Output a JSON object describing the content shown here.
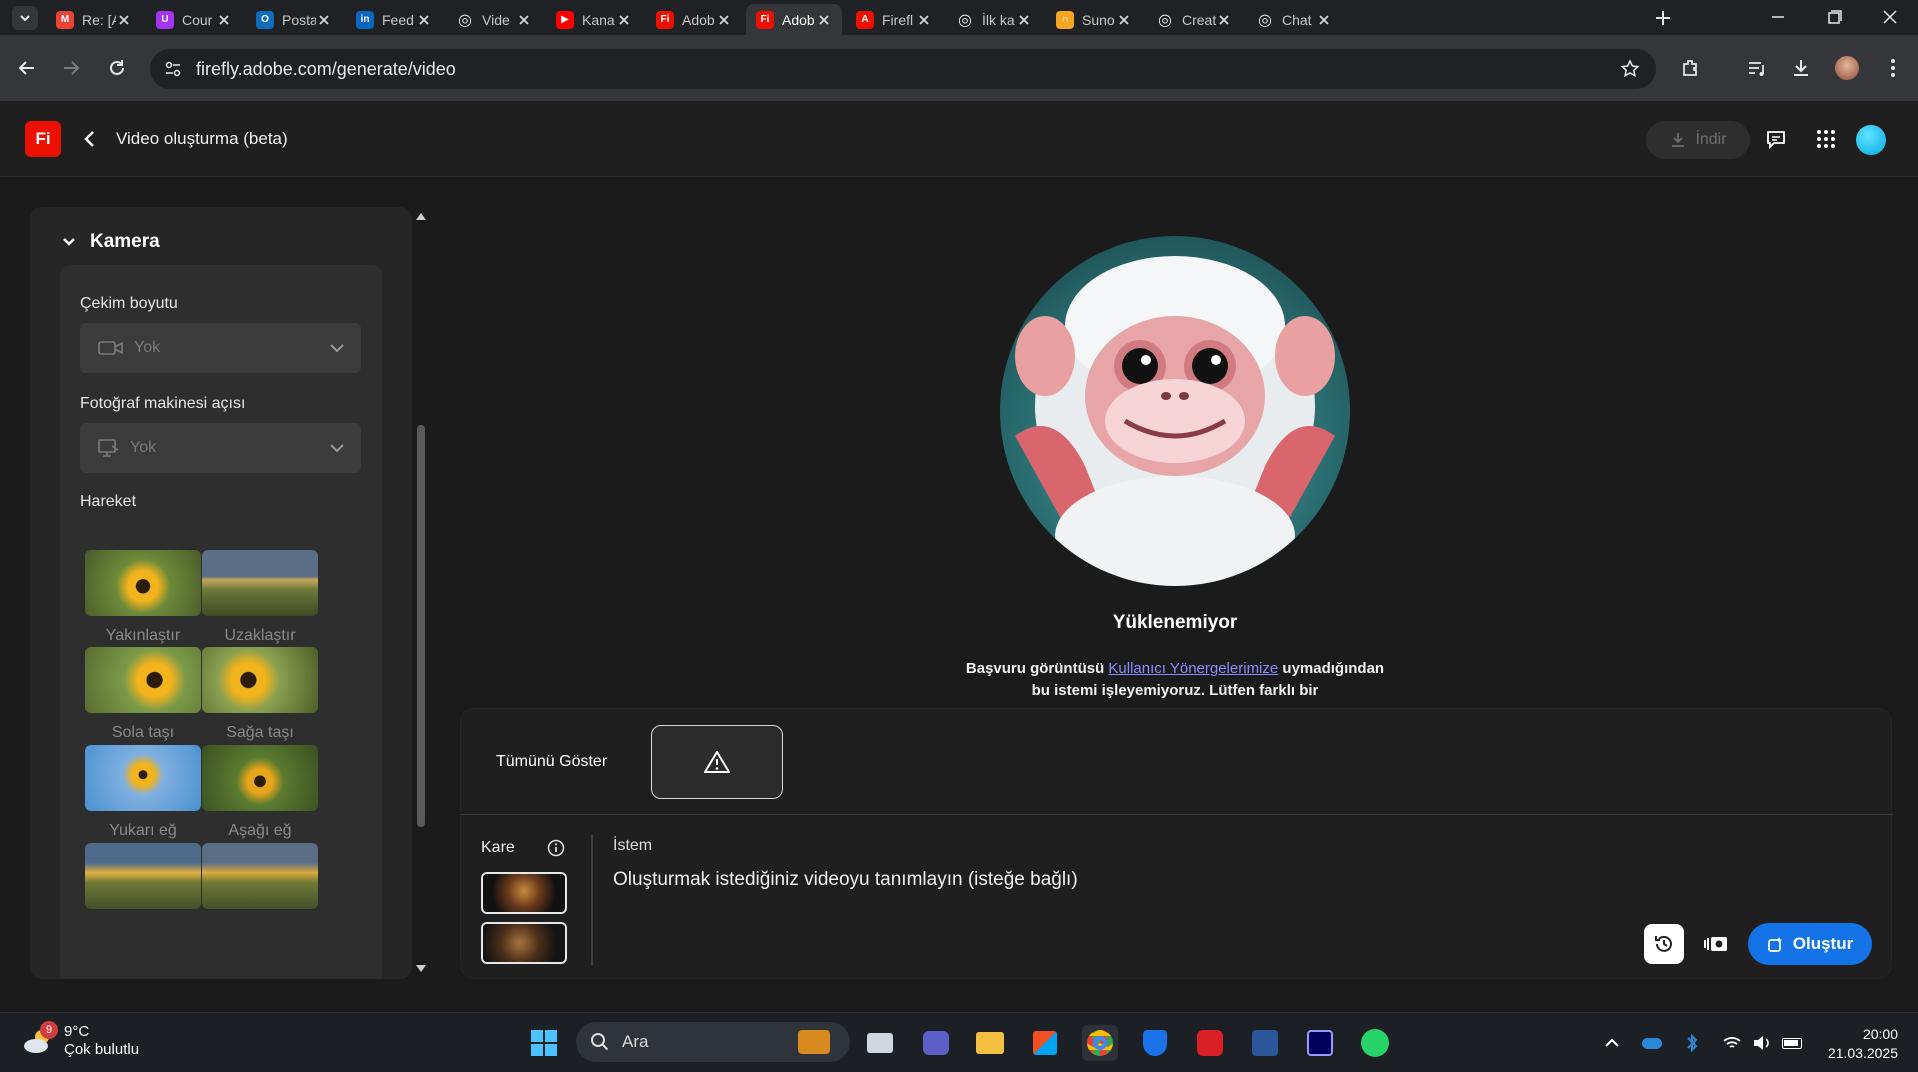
{
  "browser": {
    "tabs": [
      {
        "title": "Re: [A",
        "icon": "gmail-icon",
        "color": "#ea4335",
        "glyph": "M"
      },
      {
        "title": "Cour",
        "icon": "udemy-icon",
        "color": "#a435f0",
        "glyph": "U"
      },
      {
        "title": "Posta",
        "icon": "outlook-icon",
        "color": "#0f6cbd",
        "glyph": "O"
      },
      {
        "title": "Feed",
        "icon": "linkedin-icon",
        "color": "#0a66c2",
        "glyph": "in"
      },
      {
        "title": "Vide",
        "icon": "openai-icon",
        "color": "#e8e8e8",
        "glyph": "◎"
      },
      {
        "title": "Kana",
        "icon": "youtube-icon",
        "color": "#ff0000",
        "glyph": "▶"
      },
      {
        "title": "Adob",
        "icon": "firefly-icon",
        "color": "#eb1000",
        "glyph": "Fi"
      },
      {
        "title": "Adob",
        "icon": "firefly-icon",
        "color": "#eb1000",
        "glyph": "Fi",
        "active": true
      },
      {
        "title": "Firefl",
        "icon": "adobe-icon",
        "color": "#eb1000",
        "glyph": "A"
      },
      {
        "title": "İlk ka",
        "icon": "openai-icon",
        "color": "#e8e8e8",
        "glyph": "◎"
      },
      {
        "title": "Suno",
        "icon": "suno-icon",
        "color": "#f5a623",
        "glyph": "∩"
      },
      {
        "title": "Creat",
        "icon": "openai-icon",
        "color": "#e8e8e8",
        "glyph": "◎"
      },
      {
        "title": "Chat",
        "icon": "openai-icon",
        "color": "#e8e8e8",
        "glyph": "◎"
      }
    ],
    "url": "firefly.adobe.com/generate/video"
  },
  "app": {
    "logo": "Fi",
    "title": "Video oluşturma (beta)",
    "download_label": "İndir"
  },
  "camera_panel": {
    "heading": "Kamera",
    "shot_size_label": "Çekim boyutu",
    "shot_size_value": "Yok",
    "angle_label": "Fotoğraf makinesi açısı",
    "angle_value": "Yok",
    "motion_label": "Hareket",
    "motions": [
      "Yakınlaştır",
      "Uzaklaştır",
      "Sola taşı",
      "Sağa taşı",
      "Yukarı eğ",
      "Aşağı eğ"
    ]
  },
  "preview": {
    "error_title": "Yüklenemiyor",
    "error_text_1": "Başvuru görüntüsü ",
    "error_link": "Kullanıcı Yönergelerimize",
    "error_text_2": " uymadığından bu istemi işleyemiyoruz. Lütfen farklı bir"
  },
  "prompt_panel": {
    "show_all_label": "Tümünü Göster",
    "frame_label": "Kare",
    "prompt_label": "İstem",
    "prompt_placeholder": "Oluşturmak istediğiniz videoyu tanımlayın (isteğe bağlı)",
    "generate_label": "Oluştur"
  },
  "taskbar": {
    "weather_temp": "9°C",
    "weather_desc": "Çok bulutlu",
    "weather_badge": "9",
    "search_placeholder": "Ara",
    "time": "20:00",
    "date": "21.03.2025"
  }
}
